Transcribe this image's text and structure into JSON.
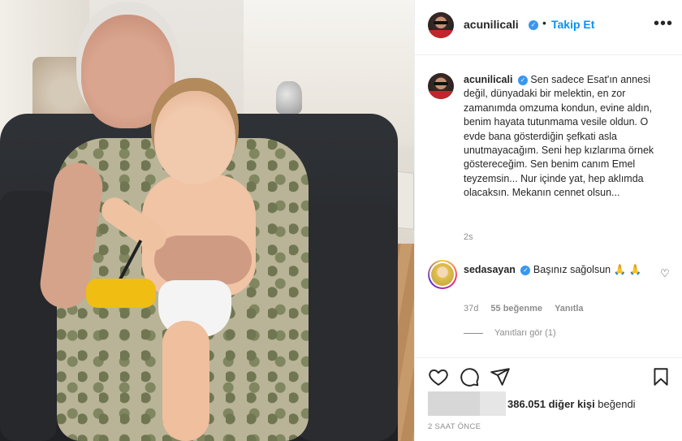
{
  "post": {
    "author": {
      "username": "acunilicali",
      "verified": true,
      "follow_separator": "•",
      "follow_label": "Takip Et",
      "more_label": "•••"
    },
    "caption": {
      "username": "acunilicali",
      "text": "Sen sadece Esat'ın annesi değil, dünyadaki bir melektin, en zor zamanımda omzuma kondun, evine aldın, benim hayata tutunmama vesile oldun. O evde bana gösterdiğin şefkati asla unutmayacağım. Seni hep kızlarıma örnek göstereceğim. Sen benim canım Emel teyzemsin... Nur içinde yat, hep aklımda olacaksın. Mekanın cennet olsun...",
      "age": "2s"
    },
    "comments": [
      {
        "username": "sedasayan",
        "verified": true,
        "text": "Başınız sağolsun 🙏 🙏",
        "age": "37d",
        "likes": "55 beğenme",
        "reply_label": "Yanıtla",
        "view_replies": "Yanıtları gör (1)"
      }
    ],
    "likes": {
      "count_text": "386.051 diğer kişi",
      "suffix": " beğendi"
    },
    "timestamp": "2 SAAT ÖNCE",
    "colors": {
      "accent": "#0095f6",
      "verified": "#3897f0",
      "muted": "#8e8e8e",
      "text": "#262626",
      "border": "#efefef"
    },
    "icons": [
      "heart-icon",
      "comment-icon",
      "share-icon",
      "bookmark-icon",
      "more-icon",
      "verified-icon",
      "comment-heart-icon"
    ]
  }
}
